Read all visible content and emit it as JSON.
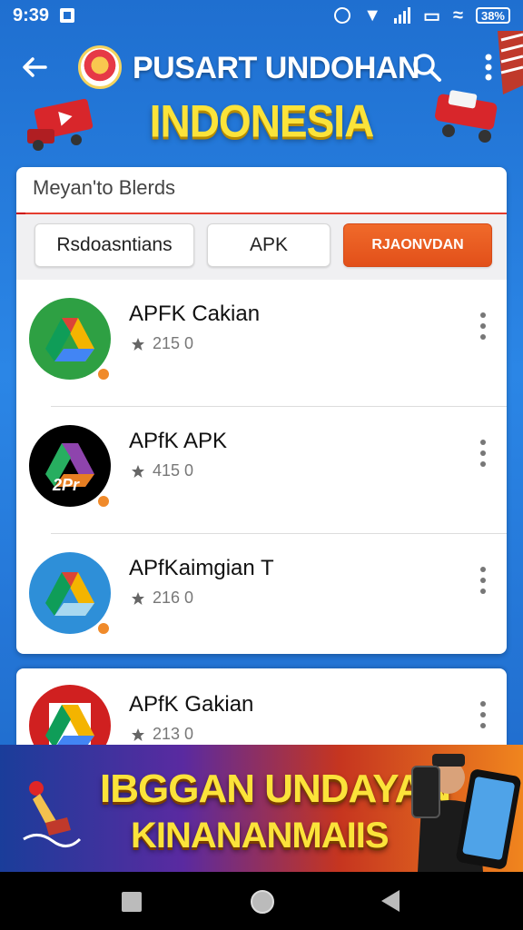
{
  "status_bar": {
    "time": "9:39",
    "battery_label": "38%"
  },
  "header": {
    "title": "PUSART UNDOHAN",
    "subtitle": "INDONESIA",
    "icons": [
      "back-arrow-icon",
      "app-logo",
      "search-icon",
      "more-vert-icon"
    ]
  },
  "search": {
    "value": "Meyan'to Blerds"
  },
  "tabs": [
    {
      "label": "Rsdoasntians",
      "active": false
    },
    {
      "label": "APK",
      "active": false
    },
    {
      "label": "RJAONVDAN",
      "active": true
    }
  ],
  "apps": [
    {
      "title": "APFK Cakian",
      "rating": "215 0",
      "icon_bg": "#2ea043",
      "icon_badge": ""
    },
    {
      "title": "APfK APK",
      "rating": "415 0",
      "icon_bg": "#000000",
      "icon_badge": "2Pr"
    },
    {
      "title": "APfKaimgian T",
      "rating": "216 0",
      "icon_bg": "#2e8fd8",
      "icon_badge": ""
    },
    {
      "title": "APfK Gakian",
      "rating": "213 0",
      "icon_bg": "#d02020",
      "icon_badge": ""
    }
  ],
  "banner": {
    "line1": "IBGGAN UNDAYAN",
    "line2": "KINANANMAIIS"
  },
  "colors": {
    "accent": "#e2501a",
    "header_blue": "#1f6fd0",
    "title_yellow": "#fbe33a"
  }
}
